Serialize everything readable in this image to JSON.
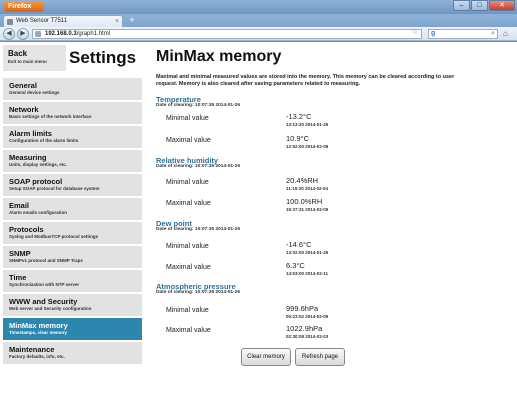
{
  "browser": {
    "menu_button": "Firefox",
    "tab_title": "Web Sensor T7511",
    "url_host": "192.168.0.3",
    "url_path": "/graph1.html",
    "search_engine_letter": "g",
    "window_controls": [
      "–",
      "□",
      "✕"
    ]
  },
  "sidebar": {
    "back": {
      "title": "Back",
      "sub": "Exit to main menu"
    },
    "heading": "Settings",
    "items": [
      {
        "title": "General",
        "sub": "General device settings"
      },
      {
        "title": "Network",
        "sub": "Basic settings of the network interface"
      },
      {
        "title": "Alarm limits",
        "sub": "Configuration of the alarm limits"
      },
      {
        "title": "Measuring",
        "sub": "Units, display settings, etc."
      },
      {
        "title": "SOAP protocol",
        "sub": "Setup SOAP protocol for database system"
      },
      {
        "title": "Email",
        "sub": "Alarm emails configuration"
      },
      {
        "title": "Protocols",
        "sub": "Syslog and ModbusTCP protocol settings"
      },
      {
        "title": "SNMP",
        "sub": "SNMPv1 protocol and SNMP Traps"
      },
      {
        "title": "Time",
        "sub": "Synchronization with NTP server"
      },
      {
        "title": "WWW and Security",
        "sub": "Web server and Security configuration"
      },
      {
        "title": "MinMax memory",
        "sub": "Timestamps, clear memory"
      },
      {
        "title": "Maintenance",
        "sub": "Factory defaults, info, etc."
      }
    ],
    "active_index": 10,
    "active_color": "#2c86ad"
  },
  "main": {
    "title": "MinMax memory",
    "intro": "Maximal and minimal measured values are stored into the memory. This memory can be cleared according to user request. Memory is also cleared after saving parameters related to measuring.",
    "sections": [
      {
        "title": "Temperature",
        "cleared": "Date of clearing: 10:07:35 2014-01-26",
        "min_label": "Minimal value",
        "min_value": "-13.2°C",
        "min_stamp": "13:13:20 2014-01-26",
        "max_label": "Maximal value",
        "max_value": "10.9°C",
        "max_stamp": "12:52:00 2014-02-08"
      },
      {
        "title": "Relative humidity",
        "cleared": "Date of clearing: 10:07:35 2014-01-26",
        "min_label": "Minimal value",
        "min_value": "20.4%RH",
        "min_stamp": "11:15:20 2014-02-04",
        "max_label": "Maximal value",
        "max_value": "100.0%RH",
        "max_stamp": "15:37:31 2014-02-09"
      },
      {
        "title": "Dew point",
        "cleared": "Date of clearing: 10:07:35 2014-01-26",
        "min_label": "Minimal value",
        "min_value": "-14.6°C",
        "min_stamp": "13:02:00 2014-01-26",
        "max_label": "Maximal value",
        "max_value": "6.3°C",
        "max_stamp": "14:53:00 2014-02-11"
      },
      {
        "title": "Atmospheric pressure",
        "cleared": "Date of clearing: 10:07:35 2014-01-26",
        "min_label": "Minimal value",
        "min_value": "999.6hPa",
        "min_stamp": "00:23:52 2014-02-09",
        "max_label": "Maximal value",
        "max_value": "1022.9hPa",
        "max_stamp": "02:30:08 2014-02-03"
      }
    ],
    "buttons": {
      "clear": "Clear memory",
      "refresh": "Refresh page"
    }
  }
}
